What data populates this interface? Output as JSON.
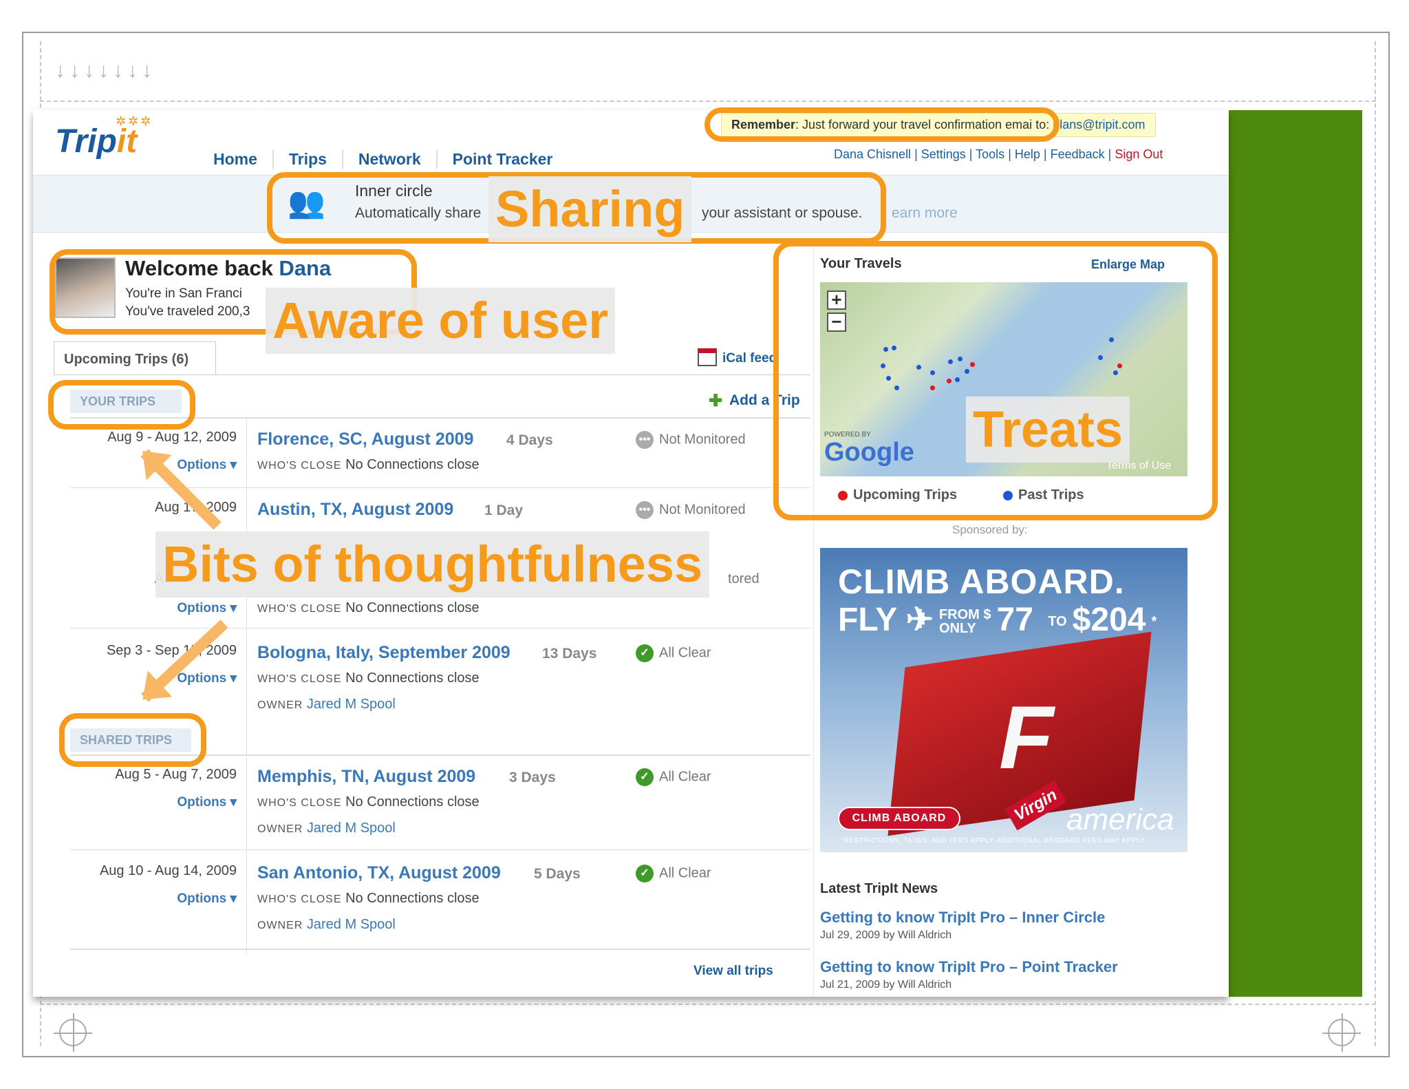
{
  "logo": {
    "text_a": "Trip",
    "text_b": "it"
  },
  "nav": [
    "Home",
    "Trips",
    "Network",
    "Point Tracker"
  ],
  "remember": {
    "label": "Remember",
    "text": ": Just forward your travel confirmation emai",
    "to": " to: ",
    "email": "plans@tripit.com"
  },
  "userlinks": {
    "name": "Dana Chisnell",
    "settings": "Settings",
    "tools": "Tools",
    "help": "Help",
    "feedback": "Feedback",
    "signout": "Sign Out",
    "sep": " | "
  },
  "inner_circle": {
    "title": "Inner circle",
    "text": "Automatically share",
    "text2": "your assistant or spouse.",
    "learn": "earn more"
  },
  "welcome": {
    "prefix": "Welcome back ",
    "name": "Dana",
    "location": "You're in San Franci",
    "traveled": "You've traveled 200,3"
  },
  "tabs": {
    "upcoming": "Upcoming Trips (6)",
    "ical": "iCal feed",
    "add_trip": "Add a Trip"
  },
  "sections": {
    "your_trips": "YOUR TRIPS",
    "shared_trips": "SHARED TRIPS"
  },
  "labels": {
    "options": "Options ▾",
    "whos_close": "WHO'S CLOSE",
    "no_connections": "No Connections close",
    "owner": "OWNER",
    "view_all": "View all trips"
  },
  "trips": [
    {
      "dates": "Aug 9 - Aug 12, 2009",
      "name": "Florence, SC, August 2009",
      "days": "4 Days",
      "status": "Not Monitored",
      "owner": ""
    },
    {
      "dates": "Aug 17, 2009",
      "name": "Austin, TX, August 2009",
      "days": "1 Day",
      "status": "Not Monitored",
      "owner": ""
    },
    {
      "dates": "A",
      "name": "",
      "days": "",
      "status": "tored",
      "owner": ""
    },
    {
      "dates": "Sep 3 - Sep 15, 2009",
      "name": "Bologna, Italy, September 2009",
      "days": "13 Days",
      "status": "All Clear",
      "owner": "Jared M Spool"
    },
    {
      "dates": "Aug 5 - Aug 7, 2009",
      "name": "Memphis, TN, August 2009",
      "days": "3 Days",
      "status": "All Clear",
      "owner": "Jared M Spool"
    },
    {
      "dates": "Aug 10 - Aug 14, 2009",
      "name": "San Antonio, TX, August 2009",
      "days": "5 Days",
      "status": "All Clear",
      "owner": "Jared M Spool"
    }
  ],
  "travels": {
    "title": "Your Travels",
    "enlarge": "Enlarge Map",
    "powered": "POWERED BY",
    "google": "Google",
    "terms": "Terms of Use",
    "legend_upcoming": "Upcoming Trips",
    "legend_past": "Past Trips"
  },
  "sponsor": {
    "label": "Sponsored by:",
    "line1": "CLIMB ABOARD.",
    "fly": "FLY",
    "from": "FROM $",
    "only": "ONLY",
    "price1": "77",
    "to": "TO",
    "price2": "$204",
    "star": "*",
    "button": "CLIMB ABOARD",
    "brand": "america",
    "virgin": "Virgin",
    "fine": "*RESTRICTIONS, TAXES, AND FEES APPLY. ADDITIONAL BAGGAGE FEES MAY APPLY"
  },
  "news": {
    "title": "Latest TripIt News",
    "items": [
      {
        "title": "Getting to know TripIt Pro – Inner Circle",
        "meta": "Jul 29, 2009 by Will Aldrich"
      },
      {
        "title": "Getting to know TripIt Pro – Point Tracker",
        "meta": "Jul 21, 2009 by Will Aldrich"
      }
    ]
  },
  "annotations": {
    "sharing": "Sharing",
    "aware": "Aware of user",
    "treats": "Treats",
    "thoughtful": "Bits of thoughtfulness"
  },
  "colors": {
    "accent_orange": "#f59a1a",
    "link_blue": "#1f5d99",
    "side_green": "#4e8a0e",
    "signout_red": "#c0142a"
  },
  "icons": {
    "arrows": "↓↓↓↓↓↓↓"
  }
}
